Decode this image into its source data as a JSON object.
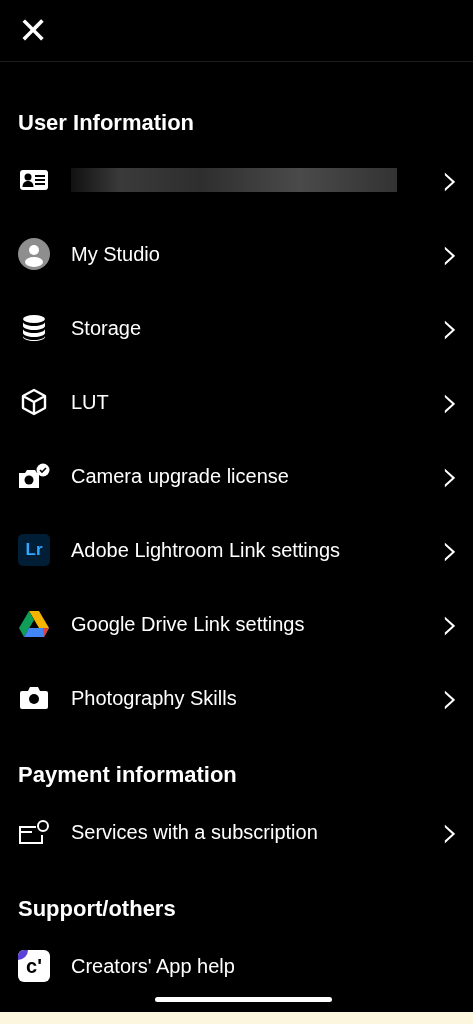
{
  "header": {
    "close_symbol": "✕"
  },
  "sections": [
    {
      "title": "User Information",
      "items": [
        {
          "kind": "idcard",
          "chevron": "›"
        },
        {
          "kind": "person",
          "label": "My Studio",
          "chevron": "›"
        },
        {
          "kind": "database",
          "label": "Storage",
          "chevron": "›"
        },
        {
          "kind": "cube",
          "label": "LUT",
          "chevron": "›"
        },
        {
          "kind": "cameracheck",
          "label": "Camera upgrade license",
          "chevron": "›"
        },
        {
          "kind": "lightroom",
          "icon_text": "Lr",
          "label": "Adobe Lightroom Link settings",
          "chevron": "›"
        },
        {
          "kind": "drive",
          "label": "Google Drive Link settings",
          "chevron": "›"
        },
        {
          "kind": "camera",
          "label": "Photography Skills",
          "chevron": "›"
        }
      ]
    },
    {
      "title": "Payment information",
      "items": [
        {
          "kind": "subscription",
          "label": "Services with a subscription",
          "chevron": "›"
        }
      ]
    },
    {
      "title": "Support/others",
      "items": [
        {
          "kind": "creators",
          "icon_text": "c'",
          "label": "Creators' App help"
        }
      ]
    }
  ]
}
